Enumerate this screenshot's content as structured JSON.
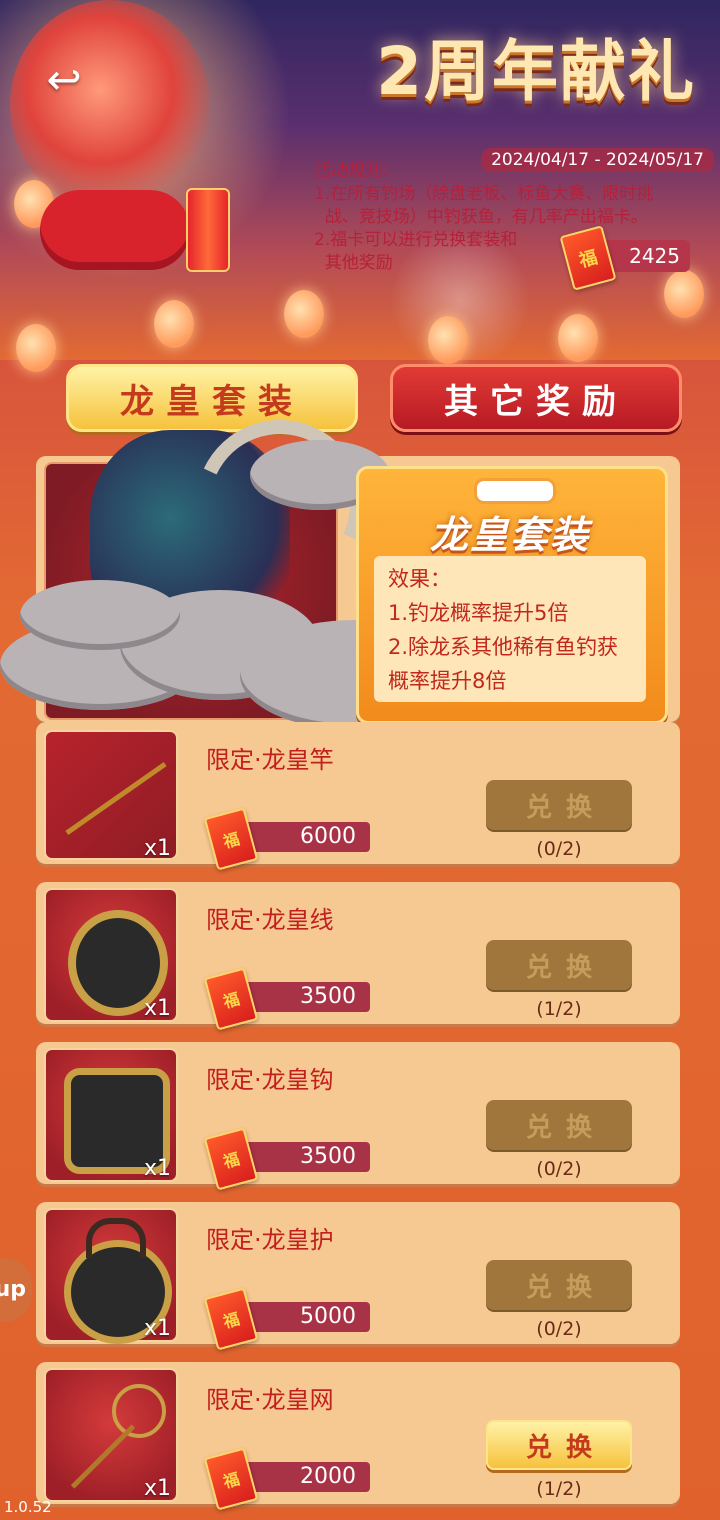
{
  "header": {
    "title": "2周年献礼",
    "back_icon_glyph": "↩",
    "date_range": "2024/04/17 - 2024/05/17",
    "rules": [
      "活动规则：",
      "1.在所有钓场（除盘老板、标鱼大赛、限时挑",
      "  战、竞技场）中钓获鱼，有几率产出福卡。",
      "2.福卡可以进行兑换套装和",
      "  其他奖励"
    ],
    "fu_card_char": "福",
    "balance": "2425"
  },
  "tabs": [
    {
      "label": "龙皇套装",
      "active": true
    },
    {
      "label": "其它奖励",
      "active": false
    }
  ],
  "suite": {
    "title": "龙皇套装",
    "effect_heading": "效果：",
    "effects": [
      "1.钓龙概率提升5倍",
      "2.除龙系其他稀有鱼钓获",
      "概率提升8倍"
    ]
  },
  "items": [
    {
      "name": "限定·龙皇竿",
      "qty": "x1",
      "cost": "6000",
      "button": "兑换",
      "progress": "(0/2)",
      "enabled": false,
      "icon": "fishing-rod-icon"
    },
    {
      "name": "限定·龙皇线",
      "qty": "x1",
      "cost": "3500",
      "button": "兑换",
      "progress": "(1/2)",
      "enabled": false,
      "icon": "fishing-line-reel-icon"
    },
    {
      "name": "限定·龙皇钩",
      "qty": "x1",
      "cost": "3500",
      "button": "兑换",
      "progress": "(0/2)",
      "enabled": false,
      "icon": "fishing-hook-icon"
    },
    {
      "name": "限定·龙皇护",
      "qty": "x1",
      "cost": "5000",
      "button": "兑换",
      "progress": "(0/2)",
      "enabled": false,
      "icon": "fish-protector-bag-icon"
    },
    {
      "name": "限定·龙皇网",
      "qty": "x1",
      "cost": "2000",
      "button": "兑换",
      "progress": "(1/2)",
      "enabled": true,
      "icon": "landing-net-icon"
    }
  ],
  "side_button": "up",
  "version": "1.0.52",
  "colors": {
    "accent_red": "#c21f1f",
    "gold": "#f6c23c",
    "panel": "#f6c992",
    "cost_bar": "#a83246"
  }
}
